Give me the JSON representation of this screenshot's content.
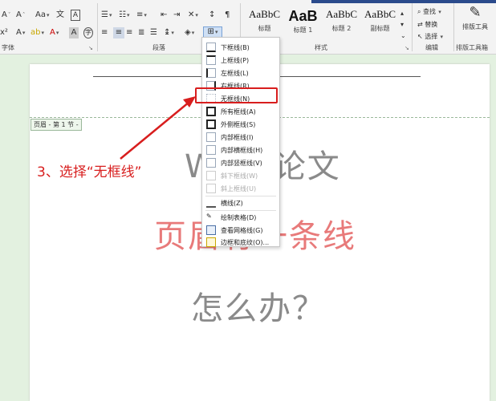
{
  "ribbon": {
    "groups": {
      "font": "字体",
      "paragraph": "段落",
      "styles": "样式",
      "editing": "编辑",
      "layout_tools": "排版工具箱"
    },
    "styles": [
      {
        "sample": "AaBbC",
        "name": "标题"
      },
      {
        "sample": "AaB",
        "name": "标题 1"
      },
      {
        "sample": "AaBbC",
        "name": "标题 2"
      },
      {
        "sample": "AaBbC",
        "name": "副标题"
      }
    ],
    "editing": {
      "find": "查找",
      "replace": "替换",
      "select": "选择"
    },
    "layout_tool_label": "排版工具"
  },
  "document": {
    "header_tag": "页眉 - 第 1 节 -",
    "line1": "Word论文",
    "line2": "页眉有一条线",
    "line3": "怎么办？"
  },
  "instruction": "3、选择“无框线”",
  "border_menu": {
    "items": [
      {
        "label": "下框线(B)",
        "disabled": false
      },
      {
        "label": "上框线(P)",
        "disabled": false
      },
      {
        "label": "左框线(L)",
        "disabled": false
      },
      {
        "label": "右框线(R)",
        "disabled": false
      },
      {
        "label": "无框线(N)",
        "disabled": false,
        "highlighted": true
      },
      {
        "label": "所有框线(A)",
        "disabled": false
      },
      {
        "label": "外侧框线(S)",
        "disabled": false
      },
      {
        "label": "内部框线(I)",
        "disabled": false
      },
      {
        "label": "内部横框线(H)",
        "disabled": false
      },
      {
        "label": "内部竖框线(V)",
        "disabled": false
      },
      {
        "label": "斜下框线(W)",
        "disabled": true
      },
      {
        "label": "斜上框线(U)",
        "disabled": true
      },
      {
        "label": "横线(Z)",
        "disabled": false
      },
      {
        "label": "绘制表格(D)",
        "disabled": false
      },
      {
        "label": "查看网格线(G)",
        "disabled": false
      },
      {
        "label": "边框和底纹(O)...",
        "disabled": false
      }
    ]
  },
  "colors": {
    "accent_red": "#d81e1e",
    "doc_background": "#e3f1e0",
    "title_gray": "#8a8a8a",
    "title_pink": "#e87a7a"
  }
}
